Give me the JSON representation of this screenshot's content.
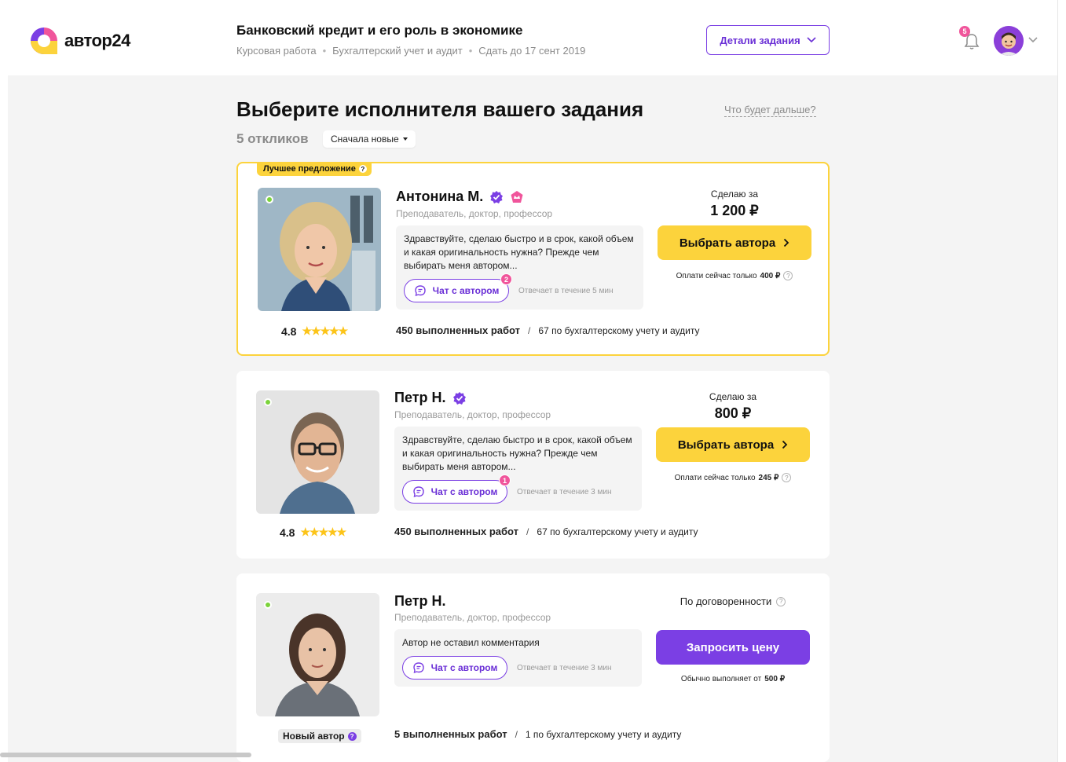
{
  "header": {
    "logo_text": "автор24",
    "task_title": "Банковский кредит и его роль в экономике",
    "task_type": "Курсовая работа",
    "task_subject": "Бухгалтерский учет и аудит",
    "task_deadline": "Сдать до 17 сент 2019",
    "details_label": "Детали задания",
    "notifications_count": "5"
  },
  "main": {
    "title": "Выберите исполнителя вашего задания",
    "next_link": "Что будет дальше?",
    "responses_count": "5 откликов",
    "sort_label": "Сначала новые"
  },
  "offers": [
    {
      "best_label": "Лучшее предложение",
      "name": "Антонина М.",
      "role": "Преподаватель, доктор, профессор",
      "comment": "Здравствуйте, сделаю быстро и в срок, какой объем и какая оригинальность нужна? Прежде чем выбирать меня автором...",
      "chat_label": "Чат с автором",
      "chat_unread": "2",
      "reply_time": "Отвечает в течение 5 мин",
      "rating": "4.8",
      "works": "450 выполненных работ",
      "subject_works": "67 по бухгалтерскому учету и аудиту",
      "price_caption": "Сделаю за",
      "price": "1 200 ₽",
      "button_label": "Выбрать автора",
      "pay_prefix": "Оплати сейчас только",
      "pay_amount": "400 ₽"
    },
    {
      "name": "Петр Н.",
      "role": "Преподаватель, доктор, профессор",
      "comment": "Здравствуйте, сделаю быстро и в срок, какой объем и какая оригинальность нужна? Прежде чем выбирать меня автором...",
      "chat_label": "Чат с автором",
      "chat_unread": "1",
      "reply_time": "Отвечает в течение 3 мин",
      "rating": "4.8",
      "works": "450 выполненных работ",
      "subject_works": "67 по бухгалтерскому учету и аудиту",
      "price_caption": "Сделаю за",
      "price": "800 ₽",
      "button_label": "Выбрать автора",
      "pay_prefix": "Оплати сейчас только",
      "pay_amount": "245 ₽"
    },
    {
      "name": "Петр Н.",
      "role": "Преподаватель, доктор, профессор",
      "comment": "Автор не оставил комментария",
      "chat_label": "Чат с автором",
      "reply_time": "Отвечает в течение 3 мин",
      "new_author_label": "Новый автор",
      "works": "5 выполненных работ",
      "subject_works": "1 по бухгалтерскому учету и аудиту",
      "price_caption": "По договоренности",
      "button_label": "Запросить цену",
      "pay_prefix": "Обычно выполняет от",
      "pay_amount": "500 ₽"
    }
  ],
  "rating_stars": "★★★★★",
  "colors": {
    "accent_purple": "#7b3fe4",
    "accent_yellow": "#fcd33c",
    "badge_pink": "#f0559b",
    "online_green": "#7bd33a"
  }
}
